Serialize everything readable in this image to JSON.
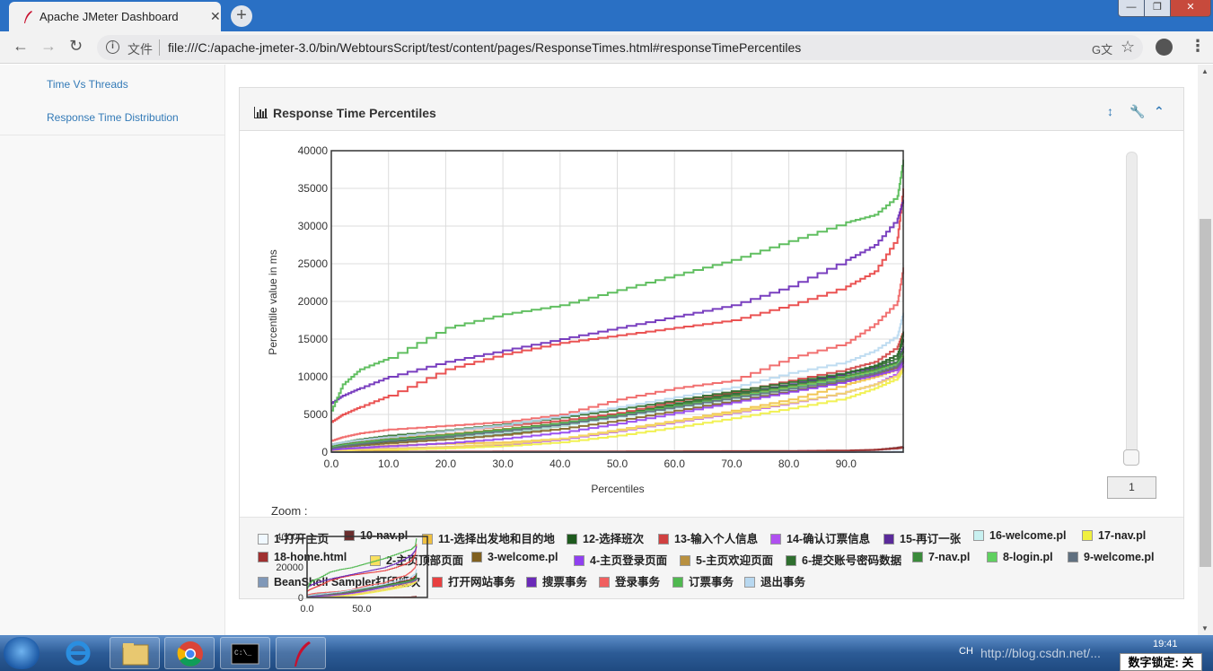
{
  "browser": {
    "tab_title": "Apache JMeter Dashboard",
    "tab_close": "✕",
    "new_tab": "+",
    "scheme_label": "文件",
    "url": "file:///C:/apache-jmeter-3.0/bin/WebtoursScript/test/content/pages/ResponseTimes.html#responseTimePercentiles",
    "win_min": "—",
    "win_max": "❐",
    "win_close": "✕",
    "back": "←",
    "forward": "→",
    "reload": "↻",
    "info": "i",
    "translate": "G文",
    "star": "☆",
    "menu": "⋮"
  },
  "sidebar": {
    "items": [
      {
        "label": "Time Vs Threads"
      },
      {
        "label": "Response Time Distribution"
      }
    ]
  },
  "panel": {
    "title": "Response Time Percentiles",
    "icons": [
      "resize-icon",
      "wrench-icon",
      "chevron-up-icon"
    ],
    "zoom_label": "Zoom :",
    "slider_value": "1"
  },
  "chart_data": {
    "type": "line",
    "xlabel": "Percentiles",
    "ylabel": "Percentile value in ms",
    "xlim": [
      0,
      100
    ],
    "ylim": [
      0,
      40000
    ],
    "xticks": [
      "0.0",
      "10.0",
      "20.0",
      "30.0",
      "40.0",
      "50.0",
      "60.0",
      "70.0",
      "80.0",
      "90.0"
    ],
    "yticks": [
      "0",
      "5000",
      "10000",
      "15000",
      "20000",
      "25000",
      "30000",
      "35000",
      "40000"
    ],
    "grid": true,
    "legend_position": "bottom",
    "x": [
      0,
      2,
      5,
      10,
      20,
      30,
      40,
      50,
      60,
      70,
      80,
      90,
      95,
      99,
      100
    ],
    "series": [
      {
        "name": "1-打开主页",
        "color": "#f0f8ff",
        "values": [
          50,
          60,
          70,
          80,
          90,
          100,
          110,
          120,
          130,
          140,
          160,
          200,
          250,
          300,
          350
        ]
      },
      {
        "name": "10-nav.pl",
        "color": "#6b2e2e",
        "values": [
          20,
          25,
          30,
          35,
          40,
          45,
          50,
          55,
          60,
          70,
          90,
          150,
          300,
          600,
          700
        ]
      },
      {
        "name": "11-选择出发地和目的地",
        "color": "#f0c040",
        "values": [
          300,
          500,
          700,
          900,
          1100,
          1300,
          1800,
          3000,
          4200,
          5500,
          7000,
          9000,
          10000,
          11000,
          12000
        ]
      },
      {
        "name": "12-选择班次",
        "color": "#1e5a1e",
        "values": [
          600,
          900,
          1100,
          1400,
          1900,
          2500,
          3500,
          5000,
          6500,
          7800,
          9000,
          10500,
          11500,
          13000,
          15000
        ]
      },
      {
        "name": "13-输入个人信息",
        "color": "#d04040",
        "values": [
          900,
          1200,
          1500,
          2000,
          2800,
          3500,
          4200,
          5200,
          6800,
          8000,
          9500,
          11000,
          12000,
          14000,
          16000
        ]
      },
      {
        "name": "14-确认订票信息",
        "color": "#b050f0",
        "values": [
          200,
          300,
          400,
          500,
          700,
          1000,
          1700,
          2800,
          4000,
          5200,
          6500,
          8000,
          9000,
          10500,
          11500
        ]
      },
      {
        "name": "15-再订一张",
        "color": "#5a2a9a",
        "values": [
          700,
          1000,
          1300,
          1600,
          2200,
          2900,
          3700,
          4900,
          6200,
          7600,
          9000,
          10500,
          11200,
          12000,
          14000
        ]
      },
      {
        "name": "16-welcome.pl",
        "color": "#c8f0f0",
        "values": [
          400,
          600,
          800,
          1200,
          1800,
          2600,
          3500,
          4600,
          5800,
          7000,
          8200,
          9500,
          10500,
          11500,
          12500
        ]
      },
      {
        "name": "17-nav.pl",
        "color": "#f0f040",
        "values": [
          100,
          150,
          200,
          300,
          500,
          800,
          1300,
          2200,
          3300,
          4500,
          5800,
          7200,
          8500,
          9800,
          11000
        ]
      },
      {
        "name": "18-home.html",
        "color": "#a03030",
        "values": [
          30,
          40,
          50,
          60,
          70,
          80,
          90,
          100,
          110,
          130,
          160,
          220,
          320,
          500,
          600
        ]
      },
      {
        "name": "2-主页顶部页面",
        "color": "#f8e060",
        "values": [
          150,
          200,
          300,
          450,
          700,
          1100,
          1800,
          2900,
          4100,
          5300,
          6600,
          8000,
          9000,
          10200,
          11200
        ]
      },
      {
        "name": "3-welcome.pl",
        "color": "#806020",
        "values": [
          500,
          700,
          900,
          1200,
          1700,
          2300,
          3100,
          4200,
          5500,
          6800,
          8100,
          9500,
          10300,
          11300,
          12200
        ]
      },
      {
        "name": "4-主页登录页面",
        "color": "#9040f0",
        "values": [
          300,
          450,
          600,
          800,
          1200,
          1800,
          2600,
          3800,
          5200,
          6600,
          8000,
          9400,
          10200,
          11000,
          12000
        ]
      },
      {
        "name": "5-主页欢迎页面",
        "color": "#b89040",
        "values": [
          800,
          1100,
          1400,
          1800,
          2400,
          3100,
          3900,
          5000,
          6200,
          7400,
          8700,
          10000,
          10800,
          11800,
          12800
        ]
      },
      {
        "name": "6-提交账号密码数据",
        "color": "#2e6e2e",
        "values": [
          1000,
          1300,
          1700,
          2200,
          2900,
          3700,
          4600,
          5700,
          6900,
          8100,
          9300,
          10600,
          11400,
          12500,
          16000
        ]
      },
      {
        "name": "7-nav.pl",
        "color": "#3a8a3a",
        "values": [
          700,
          1000,
          1300,
          1700,
          2300,
          3000,
          3900,
          5000,
          6300,
          7600,
          8900,
          10200,
          11000,
          12000,
          13500
        ]
      },
      {
        "name": "8-login.pl",
        "color": "#60d060",
        "values": [
          600,
          900,
          1200,
          1600,
          2200,
          2900,
          3800,
          4900,
          6100,
          7300,
          8600,
          9900,
          10700,
          11700,
          12700
        ]
      },
      {
        "name": "9-welcome.pl",
        "color": "#607080",
        "values": [
          500,
          800,
          1100,
          1500,
          2100,
          2800,
          3700,
          4800,
          6000,
          7200,
          8400,
          9700,
          10500,
          11500,
          12500
        ]
      },
      {
        "name": "BeanShell Sampler打印班次",
        "color": "#8098b8",
        "values": [
          5,
          5,
          5,
          5,
          5,
          5,
          5,
          5,
          5,
          5,
          5,
          5,
          10,
          20,
          30
        ]
      },
      {
        "name": "打开网站事务",
        "color": "#e84040",
        "values": [
          4000,
          5000,
          6000,
          7500,
          11000,
          13000,
          14500,
          15500,
          16500,
          17500,
          19500,
          22000,
          24000,
          28500,
          35000
        ]
      },
      {
        "name": "搜票事务",
        "color": "#6a2ab8",
        "values": [
          6500,
          7500,
          8500,
          10000,
          12000,
          13500,
          15000,
          16500,
          18000,
          19500,
          22000,
          25500,
          27500,
          31000,
          33500
        ]
      },
      {
        "name": "登录事务",
        "color": "#f06060",
        "values": [
          1500,
          2000,
          2500,
          3000,
          3500,
          4000,
          5000,
          7000,
          8500,
          9500,
          12500,
          14500,
          17000,
          20000,
          24500
        ]
      },
      {
        "name": "订票事务",
        "color": "#50b850",
        "values": [
          5500,
          9000,
          11000,
          12500,
          16500,
          18300,
          19500,
          21500,
          23500,
          25500,
          28000,
          30500,
          31500,
          34000,
          38800
        ]
      },
      {
        "name": "退出事务",
        "color": "#b8d8f0",
        "values": [
          1000,
          1300,
          1600,
          2000,
          2800,
          3600,
          4800,
          6000,
          7300,
          8600,
          10500,
          12000,
          13500,
          15500,
          18500
        ]
      }
    ],
    "overview": {
      "yticks": [
        "0",
        "20000",
        "40000"
      ],
      "xticks": [
        "0.0",
        "50.0"
      ]
    }
  },
  "taskbar": {
    "tray_lang": "CH",
    "time": "19:41",
    "numlock": "数字锁定: 关",
    "watermark": "http://blog.csdn.net/..."
  }
}
